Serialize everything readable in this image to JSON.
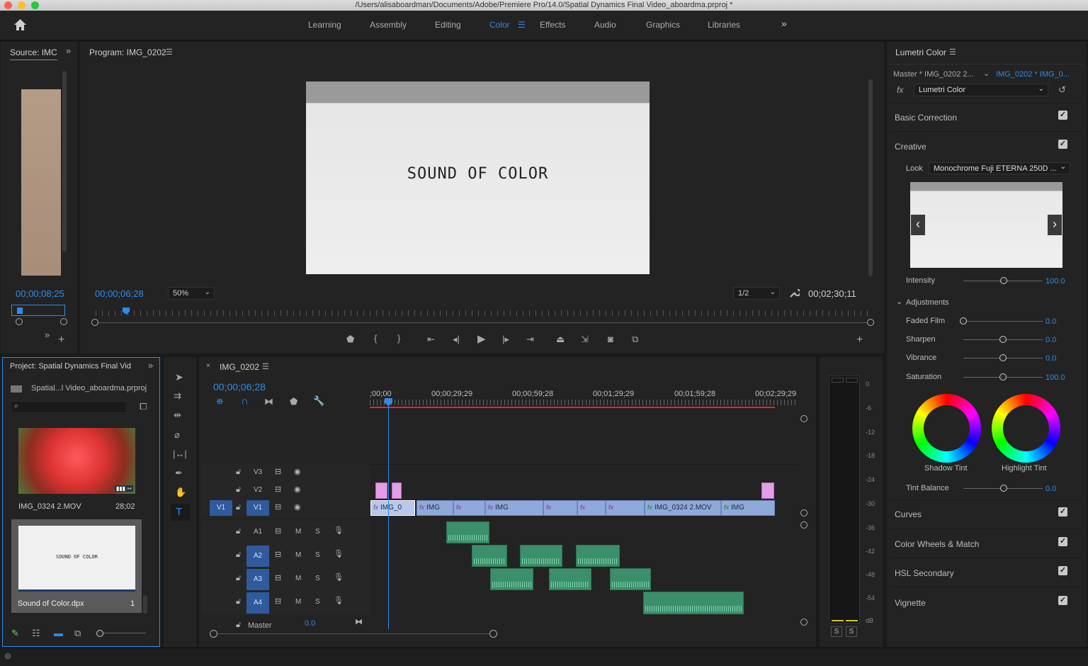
{
  "titlebar": {
    "path": "/Users/alisaboardman/Documents/Adobe/Premiere Pro/14.0/Spatial Dynamics Final Video_aboardma.prproj *"
  },
  "workspaces": {
    "items": [
      "Learning",
      "Assembly",
      "Editing",
      "Color",
      "Effects",
      "Audio",
      "Graphics",
      "Libraries"
    ],
    "active": "Color"
  },
  "source": {
    "title": "Source: IMC",
    "timecode": "00;00;08;25"
  },
  "program": {
    "title": "Program: IMG_0202",
    "frame_text": "SOUND OF COLOR",
    "timecode": "00;00;06;28",
    "zoom": "50%",
    "resolution": "1/2",
    "duration": "00;02;30;11"
  },
  "project": {
    "title": "Project: Spatial Dynamics Final Vid",
    "file": "Spatial...l Video_aboardma.prproj",
    "items": [
      {
        "name": "IMG_0324 2.MOV",
        "duration": "28;02"
      },
      {
        "name": "Sound of Color.dpx",
        "duration": "1",
        "thumb_text": "SOUND OF COLOR"
      }
    ]
  },
  "timeline": {
    "tab": "IMG_0202",
    "timecode": "00;00;06;28",
    "ruler": [
      ";00;00",
      "00;00;29;29",
      "00;00;59;28",
      "00;01;29;29",
      "00;01;59;28",
      "00;02;29;29"
    ],
    "video_tracks": [
      "V3",
      "V2",
      "V1"
    ],
    "source_patch_v": "V1",
    "audio_tracks": [
      "A1",
      "A2",
      "A3",
      "A4"
    ],
    "mute": "M",
    "solo": "S",
    "master": "Master",
    "master_value": "0.0",
    "clips": {
      "c1": "IMG_0",
      "c2": "IMG",
      "c3": "IMG",
      "c4": "IMG_0324 2.MOV",
      "c5": "IMG",
      "fx": "fx"
    }
  },
  "vu_meter": {
    "scale": [
      "0",
      "-6",
      "-12",
      "-18",
      "-24",
      "-30",
      "-36",
      "-42",
      "-48",
      "-54",
      "dB"
    ],
    "solo_left": "S",
    "solo_right": "S"
  },
  "lumetri": {
    "title": "Lumetri Color",
    "master_clip": "Master * IMG_0202 2...",
    "active_clip": "IMG_0202 * IMG_0...",
    "effect": "Lumetri Color",
    "fx_label": "fx",
    "sections": {
      "basic": "Basic Correction",
      "creative": "Creative",
      "curves": "Curves",
      "wheels": "Color Wheels & Match",
      "hsl": "HSL Secondary",
      "vignette": "Vignette"
    },
    "look_label": "Look",
    "look_value": "Monochrome Fuji ETERNA 250D ...",
    "intensity_label": "Intensity",
    "intensity_value": "100.0",
    "adjustments": "Adjustments",
    "sliders": [
      {
        "label": "Faded Film",
        "value": "0.0",
        "level": 0.0
      },
      {
        "label": "Sharpen",
        "value": "0.0",
        "level": 0.5
      },
      {
        "label": "Vibrance",
        "value": "0.0",
        "level": 0.5
      },
      {
        "label": "Saturation",
        "value": "100.0",
        "level": 0.5
      }
    ],
    "shadow_tint": "Shadow Tint",
    "highlight_tint": "Highlight Tint",
    "tint_balance_label": "Tint Balance",
    "tint_balance_value": "0.0"
  },
  "colors": {
    "accent_blue": "#2d8ceb",
    "video_clip": "#8fa9d9",
    "audio_clip": "#3c8f6b",
    "graphic_clip": "#e49ee8",
    "work_area": "#e02b2b"
  }
}
